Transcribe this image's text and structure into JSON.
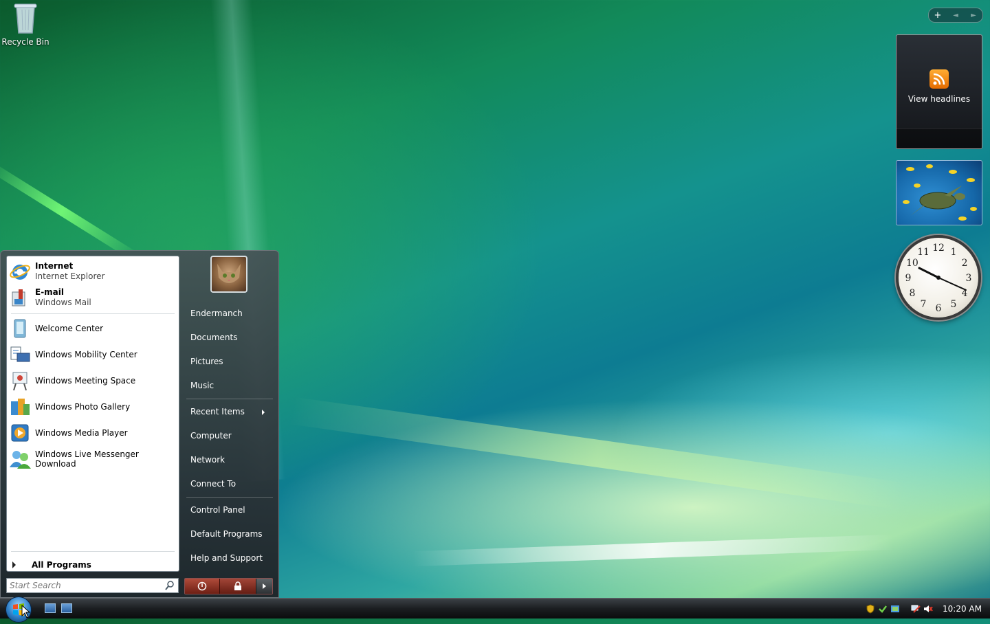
{
  "desktop": {
    "icons": [
      {
        "label": "Recycle Bin",
        "icon": "recycle-bin-icon"
      }
    ]
  },
  "sidebar": {
    "controls": {
      "add": "+",
      "prev": "◄",
      "next": "►"
    },
    "feed_gadget": {
      "label": "View headlines",
      "icon": "rss-icon"
    },
    "clock_gadget": {
      "time": "10:20",
      "numbers": [
        "12",
        "1",
        "2",
        "3",
        "4",
        "5",
        "6",
        "7",
        "8",
        "9",
        "10",
        "11"
      ]
    }
  },
  "start_menu": {
    "pinned": [
      {
        "title": "Internet",
        "subtitle": "Internet Explorer",
        "icon": "internet-explorer-icon"
      },
      {
        "title": "E-mail",
        "subtitle": "Windows Mail",
        "icon": "windows-mail-icon"
      }
    ],
    "recent": [
      {
        "label": "Welcome Center",
        "icon": "welcome-center-icon"
      },
      {
        "label": "Windows Mobility Center",
        "icon": "mobility-center-icon"
      },
      {
        "label": "Windows Meeting Space",
        "icon": "meeting-space-icon"
      },
      {
        "label": "Windows Photo Gallery",
        "icon": "photo-gallery-icon"
      },
      {
        "label": "Windows Media Player",
        "icon": "media-player-icon"
      },
      {
        "label": "Windows Live Messenger Download",
        "icon": "messenger-icon"
      }
    ],
    "all_programs": "All Programs",
    "search_placeholder": "Start Search",
    "right": {
      "username": "Endermanch",
      "items": [
        "Documents",
        "Pictures",
        "Music",
        "Recent Items",
        "Computer",
        "Network",
        "Connect To",
        "Control Panel",
        "Default Programs",
        "Help and Support"
      ]
    }
  },
  "taskbar": {
    "clock": "10:20 AM",
    "quick_launch": [
      "show-desktop-icon",
      "switch-windows-icon"
    ],
    "tray_icons": [
      "security-shield-icon",
      "windows-update-icon",
      "defender-icon",
      "network-icon",
      "volume-muted-icon"
    ]
  },
  "colors": {
    "accent": "#2f7fc7",
    "power": "#b04b3a"
  }
}
